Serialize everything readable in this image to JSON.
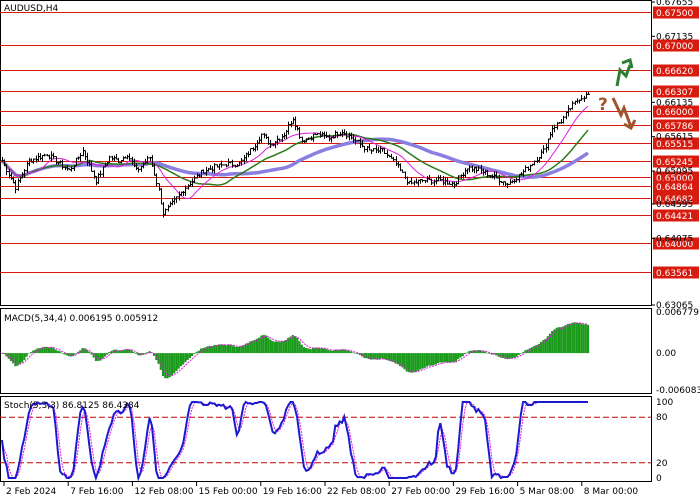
{
  "title": "AUDUSD,H4",
  "colors": {
    "grid": "#000000",
    "level_line": "#d81b0f",
    "price_label_bg": "#d81b0f",
    "bar": "#000000",
    "ma_fast": "#e01ee0",
    "ma_mid": "#2b7a1a",
    "ma_slow": "#8a7fe0",
    "macd_hist": "#1a9a1a",
    "macd_signal": "#e01ee0",
    "stoch_main": "#1a1ad0",
    "stoch_signal": "#e01ee0",
    "stoch_level": "#c00000",
    "arrow_up": "#2e7d32",
    "arrow_down": "#a0522d"
  },
  "main_panel": {
    "plain_ticks": [
      "0.67655",
      "0.67135",
      "0.66135",
      "0.65615",
      "0.65095",
      "0.64595",
      "0.64075",
      "0.63065"
    ],
    "levels": [
      "0.67500",
      "0.67000",
      "0.66620",
      "0.66307",
      "0.66000",
      "0.65786",
      "0.65515",
      "0.65245",
      "0.65000",
      "0.64864",
      "0.64682",
      "0.64421",
      "0.64000",
      "0.63561"
    ],
    "signals": {
      "up_arrow_icon": "double-chevron-up-icon",
      "question_mark": "?",
      "down_arrow_icon": "zigzag-down-arrow-icon"
    }
  },
  "macd_panel": {
    "label": "MACD(5,34,4) 0.006195 0.005912",
    "ticks": [
      "0.006779",
      "0.00",
      "-0.006083"
    ]
  },
  "stoch_panel": {
    "label": "Stoch(5,3,3) 86.8125 86.4384",
    "ticks": [
      "100",
      "80",
      "20",
      "0"
    ]
  },
  "time_axis": [
    "2 Feb 2024",
    "7 Feb 16:00",
    "12 Feb 08:00",
    "15 Feb 00:00",
    "19 Feb 16:00",
    "22 Feb 08:00",
    "27 Feb 00:00",
    "29 Feb 16:00",
    "5 Mar 08:00",
    "8 Mar 00:00"
  ],
  "chart_data": {
    "type": "line",
    "instrument": "AUDUSD,H4",
    "price_anchors": [
      {
        "i": 0,
        "p": 0.6525
      },
      {
        "i": 6,
        "p": 0.6485
      },
      {
        "i": 12,
        "p": 0.6525
      },
      {
        "i": 20,
        "p": 0.6535
      },
      {
        "i": 30,
        "p": 0.651
      },
      {
        "i": 36,
        "p": 0.654
      },
      {
        "i": 42,
        "p": 0.6495
      },
      {
        "i": 48,
        "p": 0.653
      },
      {
        "i": 52,
        "p": 0.6525
      },
      {
        "i": 56,
        "p": 0.6535
      },
      {
        "i": 60,
        "p": 0.651
      },
      {
        "i": 66,
        "p": 0.653
      },
      {
        "i": 70,
        "p": 0.648
      },
      {
        "i": 72,
        "p": 0.6445
      },
      {
        "i": 76,
        "p": 0.646
      },
      {
        "i": 82,
        "p": 0.6485
      },
      {
        "i": 90,
        "p": 0.651
      },
      {
        "i": 100,
        "p": 0.652
      },
      {
        "i": 106,
        "p": 0.652
      },
      {
        "i": 112,
        "p": 0.6545
      },
      {
        "i": 116,
        "p": 0.6565
      },
      {
        "i": 120,
        "p": 0.655
      },
      {
        "i": 126,
        "p": 0.6565
      },
      {
        "i": 130,
        "p": 0.659
      },
      {
        "i": 134,
        "p": 0.6555
      },
      {
        "i": 140,
        "p": 0.6565
      },
      {
        "i": 146,
        "p": 0.656
      },
      {
        "i": 152,
        "p": 0.657
      },
      {
        "i": 158,
        "p": 0.6555
      },
      {
        "i": 164,
        "p": 0.654
      },
      {
        "i": 170,
        "p": 0.654
      },
      {
        "i": 176,
        "p": 0.652
      },
      {
        "i": 182,
        "p": 0.649
      },
      {
        "i": 188,
        "p": 0.6495
      },
      {
        "i": 196,
        "p": 0.6495
      },
      {
        "i": 202,
        "p": 0.649
      },
      {
        "i": 208,
        "p": 0.6515
      },
      {
        "i": 214,
        "p": 0.651
      },
      {
        "i": 220,
        "p": 0.65
      },
      {
        "i": 226,
        "p": 0.649
      },
      {
        "i": 232,
        "p": 0.6505
      },
      {
        "i": 238,
        "p": 0.6525
      },
      {
        "i": 242,
        "p": 0.654
      },
      {
        "i": 246,
        "p": 0.6575
      },
      {
        "i": 250,
        "p": 0.6585
      },
      {
        "i": 254,
        "p": 0.6605
      },
      {
        "i": 258,
        "p": 0.662
      },
      {
        "i": 262,
        "p": 0.6625
      }
    ],
    "bar_count": 263,
    "ylim": [
      0.63065,
      0.67655
    ],
    "macd_range": [
      -0.006083,
      0.006779
    ],
    "stoch_range": [
      0,
      100
    ],
    "stoch_levels": [
      20,
      80
    ]
  }
}
